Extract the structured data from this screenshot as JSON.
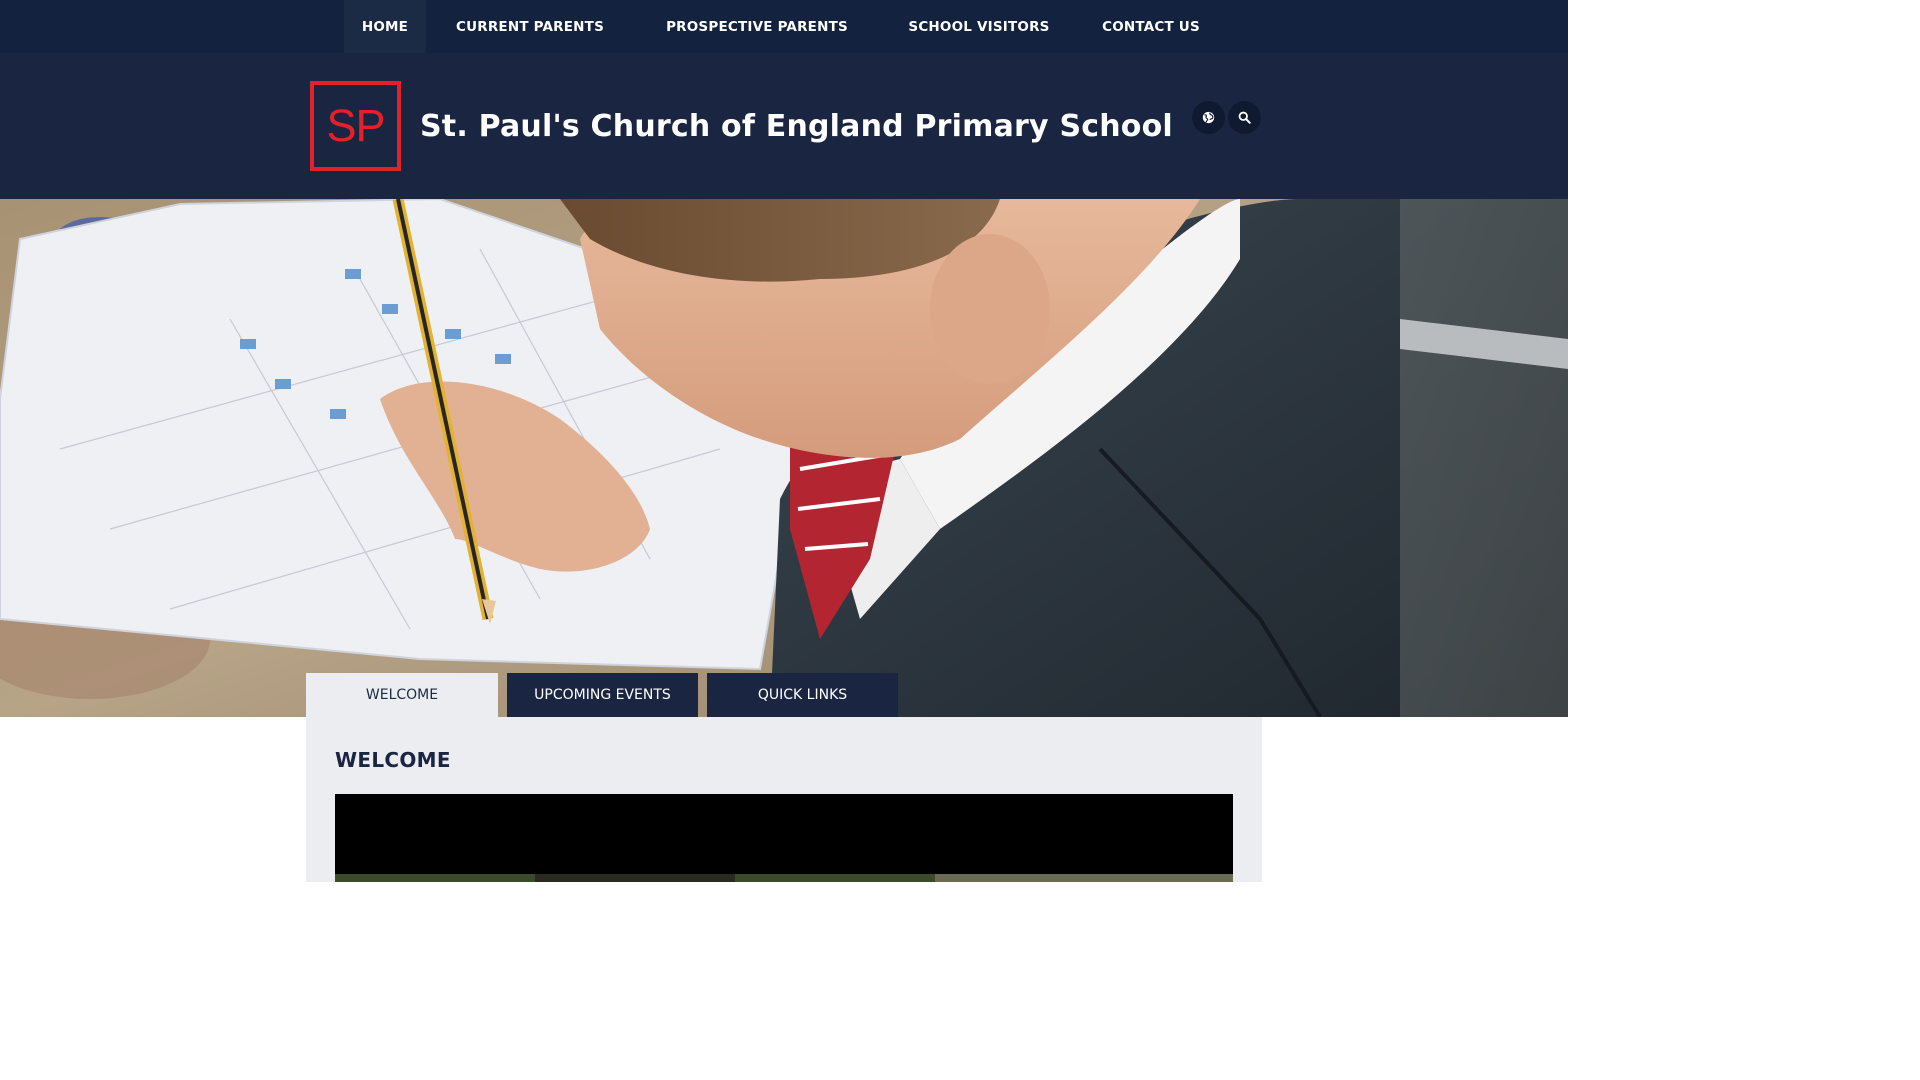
{
  "nav": {
    "items": [
      {
        "label": "HOME",
        "active": true
      },
      {
        "label": "CURRENT PARENTS",
        "active": false
      },
      {
        "label": "PROSPECTIVE PARENTS",
        "active": false
      },
      {
        "label": "SCHOOL VISITORS",
        "active": false
      },
      {
        "label": "CONTACT US",
        "active": false
      }
    ]
  },
  "header": {
    "logo_text": "SP",
    "school_name": "St. Paul's Church of England Primary School",
    "icons": [
      "globe-icon",
      "search-icon"
    ]
  },
  "hero": {
    "image": "photo-child-writing-in-workbook"
  },
  "tabs": [
    {
      "label": "WELCOME",
      "active": true
    },
    {
      "label": "UPCOMING EVENTS",
      "active": false
    },
    {
      "label": "QUICK LINKS",
      "active": false
    }
  ],
  "content": {
    "heading": "WELCOME"
  },
  "colors": {
    "nav_bg": "#13233f",
    "header_bg": "#1a2641",
    "logo_red": "#e4212a",
    "panel_bg": "#ecedf0"
  }
}
